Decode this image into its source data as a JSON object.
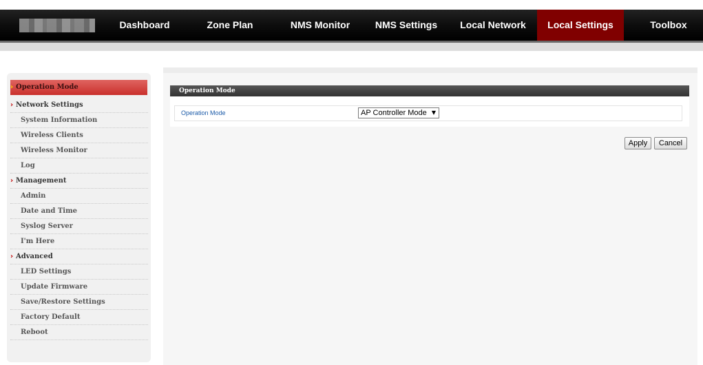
{
  "nav": {
    "items": [
      {
        "label": "Dashboard"
      },
      {
        "label": "Zone Plan"
      },
      {
        "label": "NMS Monitor"
      },
      {
        "label": "NMS Settings"
      },
      {
        "label": "Local Network"
      },
      {
        "label": "Local Settings",
        "active": true
      },
      {
        "label": "Toolbox"
      }
    ],
    "active_color": "#800000"
  },
  "sidebar": {
    "active": "Operation Mode",
    "sections": [
      {
        "label": "Operation Mode"
      },
      {
        "label": "Network Settings"
      },
      {
        "label": "System Information"
      },
      {
        "label": "Wireless Clients"
      },
      {
        "label": "Wireless Monitor"
      },
      {
        "label": "Log"
      },
      {
        "label": "Management"
      },
      {
        "label": "Admin"
      },
      {
        "label": "Date and Time"
      },
      {
        "label": "Syslog Server"
      },
      {
        "label": "I'm Here"
      },
      {
        "label": "Advanced"
      },
      {
        "label": "LED Settings"
      },
      {
        "label": "Update Firmware"
      },
      {
        "label": "Save/Restore Settings"
      },
      {
        "label": "Factory Default"
      },
      {
        "label": "Reboot"
      }
    ]
  },
  "main": {
    "section_title": "Operation Mode",
    "field_label": "Operation Mode",
    "field_value": "AP Controller Mode",
    "apply_label": "Apply",
    "cancel_label": "Cancel"
  },
  "icons": {
    "section_arrow": "chevron-right-icon",
    "dropdown_arrow": "dropdown-arrow-icon"
  }
}
